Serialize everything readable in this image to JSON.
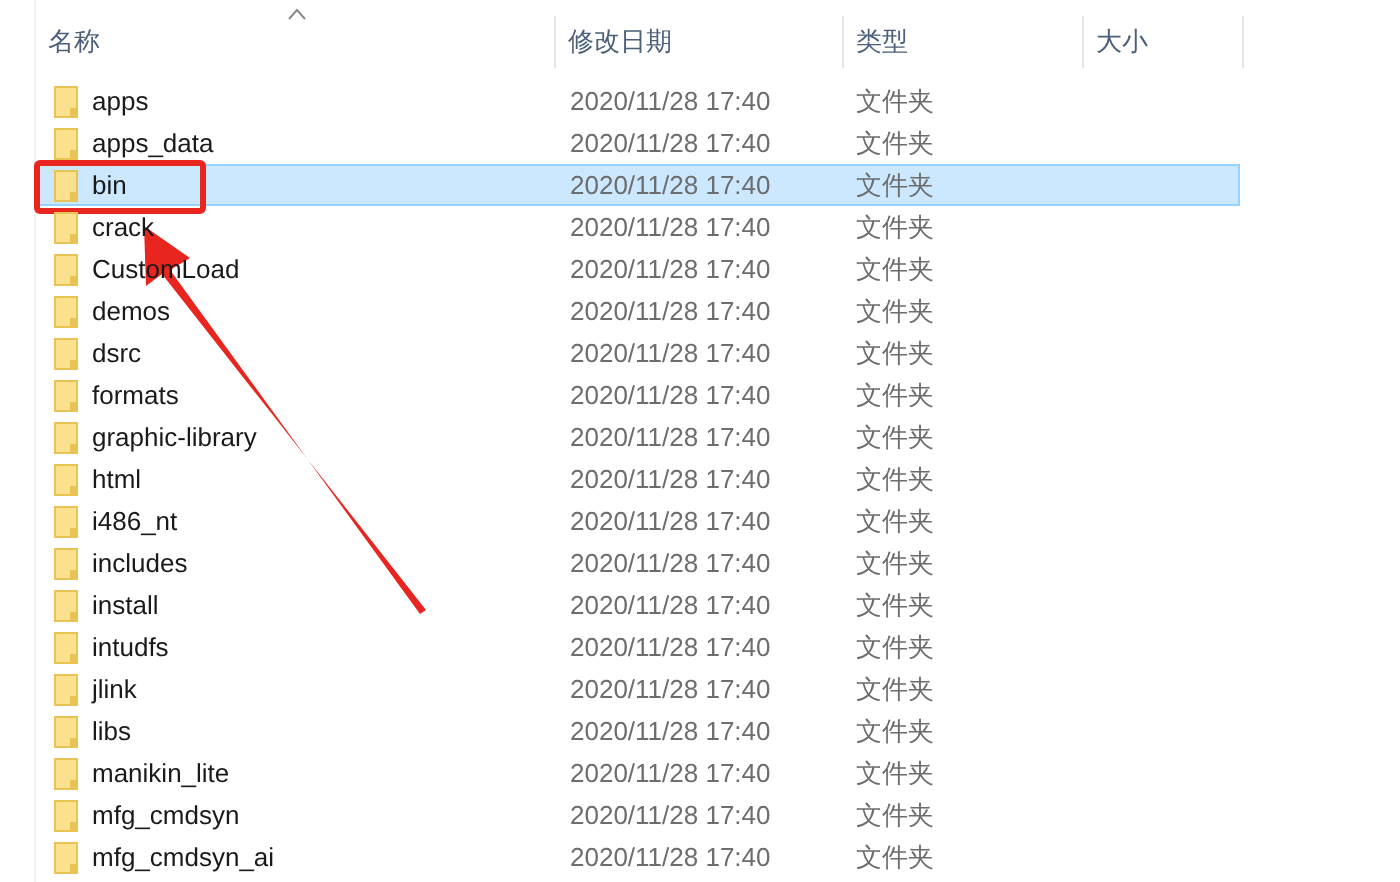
{
  "columns": [
    {
      "label": "名称",
      "sorted": true
    },
    {
      "label": "修改日期",
      "sorted": false
    },
    {
      "label": "类型",
      "sorted": false
    },
    {
      "label": "大小",
      "sorted": false
    }
  ],
  "rows": [
    {
      "name": "apps",
      "modified": "2020/11/28 17:40",
      "type": "文件夹",
      "selected": false,
      "annotated": false
    },
    {
      "name": "apps_data",
      "modified": "2020/11/28 17:40",
      "type": "文件夹",
      "selected": false,
      "annotated": false
    },
    {
      "name": "bin",
      "modified": "2020/11/28 17:40",
      "type": "文件夹",
      "selected": true,
      "annotated": true
    },
    {
      "name": "crack",
      "modified": "2020/11/28 17:40",
      "type": "文件夹",
      "selected": false,
      "annotated": false
    },
    {
      "name": "CustomLoad",
      "modified": "2020/11/28 17:40",
      "type": "文件夹",
      "selected": false,
      "annotated": false
    },
    {
      "name": "demos",
      "modified": "2020/11/28 17:40",
      "type": "文件夹",
      "selected": false,
      "annotated": false
    },
    {
      "name": "dsrc",
      "modified": "2020/11/28 17:40",
      "type": "文件夹",
      "selected": false,
      "annotated": false
    },
    {
      "name": "formats",
      "modified": "2020/11/28 17:40",
      "type": "文件夹",
      "selected": false,
      "annotated": false
    },
    {
      "name": "graphic-library",
      "modified": "2020/11/28 17:40",
      "type": "文件夹",
      "selected": false,
      "annotated": false
    },
    {
      "name": "html",
      "modified": "2020/11/28 17:40",
      "type": "文件夹",
      "selected": false,
      "annotated": false
    },
    {
      "name": "i486_nt",
      "modified": "2020/11/28 17:40",
      "type": "文件夹",
      "selected": false,
      "annotated": false
    },
    {
      "name": "includes",
      "modified": "2020/11/28 17:40",
      "type": "文件夹",
      "selected": false,
      "annotated": false
    },
    {
      "name": "install",
      "modified": "2020/11/28 17:40",
      "type": "文件夹",
      "selected": false,
      "annotated": false
    },
    {
      "name": "intudfs",
      "modified": "2020/11/28 17:40",
      "type": "文件夹",
      "selected": false,
      "annotated": false
    },
    {
      "name": "jlink",
      "modified": "2020/11/28 17:40",
      "type": "文件夹",
      "selected": false,
      "annotated": false
    },
    {
      "name": "libs",
      "modified": "2020/11/28 17:40",
      "type": "文件夹",
      "selected": false,
      "annotated": false
    },
    {
      "name": "manikin_lite",
      "modified": "2020/11/28 17:40",
      "type": "文件夹",
      "selected": false,
      "annotated": false
    },
    {
      "name": "mfg_cmdsyn",
      "modified": "2020/11/28 17:40",
      "type": "文件夹",
      "selected": false,
      "annotated": false
    },
    {
      "name": "mfg_cmdsyn_ai",
      "modified": "2020/11/28 17:40",
      "type": "文件夹",
      "selected": false,
      "annotated": false
    }
  ]
}
